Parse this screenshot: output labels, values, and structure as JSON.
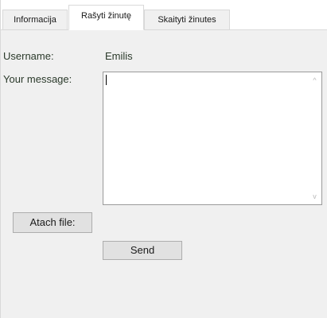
{
  "tabs": [
    {
      "label": "Informacija"
    },
    {
      "label": "Rašyti žinutę"
    },
    {
      "label": "Skaityti žinutes"
    }
  ],
  "form": {
    "username_label": "Username:",
    "username_value": "Emilis",
    "message_label": "Your message:",
    "message_value": ""
  },
  "buttons": {
    "attach_label": "Atach file:",
    "send_label": "Send"
  },
  "scrollbar": {
    "up_glyph": "^",
    "down_glyph": "v"
  },
  "colors": {
    "window_bg": "#f0f0f0",
    "button_bg": "#e1e1e1",
    "label_text": "#2b3a2b"
  }
}
